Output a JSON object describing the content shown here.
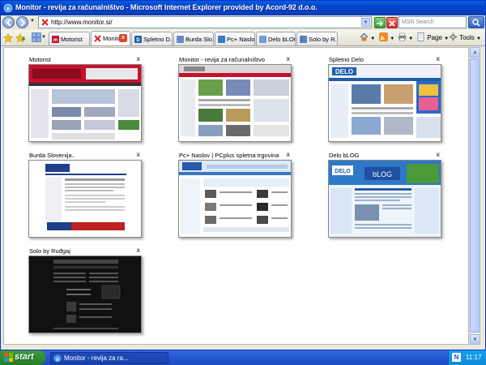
{
  "window": {
    "title": "Monitor - revija za računalništvo - Microsoft Internet Explorer provided by Acord-92 d.o.o."
  },
  "address": {
    "url": "http://www.monitor.si/",
    "search_placeholder": "MSN Search"
  },
  "tabs": [
    {
      "label": "Motorist",
      "active": false,
      "icon": "page-icon"
    },
    {
      "label": "Monitor - revija...",
      "active": true,
      "icon": "monitor-favicon-icon"
    },
    {
      "label": "Spletno D...",
      "active": false,
      "icon": "page-icon"
    },
    {
      "label": "Burda Slo...",
      "active": false,
      "icon": "page-icon"
    },
    {
      "label": "Pc+ Naslo...",
      "active": false,
      "icon": "page-icon"
    },
    {
      "label": "Delo bLOG",
      "active": false,
      "icon": "page-icon"
    },
    {
      "label": "Solo by R...",
      "active": false,
      "icon": "page-icon"
    }
  ],
  "command_bar": {
    "page_label": "Page",
    "tools_label": "Tools"
  },
  "quick_tabs": [
    {
      "title": "Motorist",
      "close": "x",
      "theme": "motorist"
    },
    {
      "title": "Monitor - revija za računalništvo",
      "close": "x",
      "theme": "monitor"
    },
    {
      "title": "Spletno Delo",
      "close": "x",
      "theme": "delo"
    },
    {
      "title": "Burda Slovenija..",
      "close": "x",
      "theme": "burda"
    },
    {
      "title": "Pc+ Naslov | PCplus spletna trgovina",
      "close": "x",
      "theme": "pcplus"
    },
    {
      "title": "Delo bLOG",
      "close": "x",
      "theme": "blog"
    },
    {
      "title": "Solo by Ruđgaj",
      "close": "x",
      "theme": "solo"
    }
  ],
  "taskbar": {
    "start_label": "start",
    "task_label": "Monitor - revija za ra...",
    "tray_letter": "N",
    "clock": "11:17"
  },
  "colors": {
    "xp_blue": "#0a5ed7",
    "start_green": "#2f8c2f",
    "motorist_red": "#c8102e",
    "delo_blue": "#1f5fa8",
    "blog_blue": "#2f78c8"
  }
}
